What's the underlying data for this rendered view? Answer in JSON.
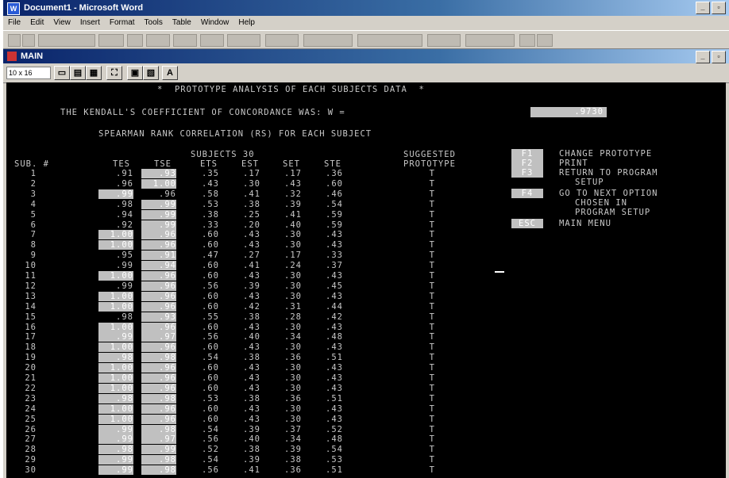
{
  "window": {
    "title": "Document1 - Microsoft Word"
  },
  "menu": [
    "File",
    "Edit",
    "View",
    "Insert",
    "Format",
    "Tools",
    "Table",
    "Window",
    "Help"
  ],
  "sub_window": {
    "title": "MAIN"
  },
  "dos_toolbar": {
    "font_size": "10 x 16"
  },
  "screen": {
    "header": "*  PROTOTYPE ANALYSIS OF EACH SUBJECTS DATA  *",
    "kendall_label": "THE KENDALL'S COEFFICIENT OF CONCORDANCE WAS: W =",
    "kendall_value": ".9730",
    "spearman_label": "SPEARMAN RANK CORRELATION (RS) FOR EACH SUBJECT",
    "subjects_label": "SUBJECTS 30",
    "suggested_label": "SUGGESTED",
    "prototype_label": "PROTOTYPE",
    "columns": [
      "SUB. #",
      "TES",
      "TSE",
      "ETS",
      "EST",
      "SET",
      "STE"
    ],
    "rows": [
      {
        "sub": "1",
        "tes": ".91",
        "tse": ".93",
        "ets": ".35",
        "est": ".17",
        "set": ".17",
        "ste": ".36",
        "p": "T"
      },
      {
        "sub": "2",
        "tes": ".96",
        "tse": "1.00",
        "ets": ".43",
        "est": ".30",
        "set": ".43",
        "ste": ".60",
        "p": "T"
      },
      {
        "sub": "3",
        "tes": ".99",
        "tse": ".96",
        "ets": ".58",
        "est": ".41",
        "set": ".32",
        "ste": ".46",
        "p": "T"
      },
      {
        "sub": "4",
        "tes": ".98",
        "tse": ".99",
        "ets": ".53",
        "est": ".38",
        "set": ".39",
        "ste": ".54",
        "p": "T"
      },
      {
        "sub": "5",
        "tes": ".94",
        "tse": ".99",
        "ets": ".38",
        "est": ".25",
        "set": ".41",
        "ste": ".59",
        "p": "T"
      },
      {
        "sub": "6",
        "tes": ".92",
        "tse": ".99",
        "ets": ".33",
        "est": ".20",
        "set": ".40",
        "ste": ".59",
        "p": "T"
      },
      {
        "sub": "7",
        "tes": "1.00",
        "tse": ".96",
        "ets": ".60",
        "est": ".43",
        "set": ".30",
        "ste": ".43",
        "p": "T"
      },
      {
        "sub": "8",
        "tes": "1.00",
        "tse": ".96",
        "ets": ".60",
        "est": ".43",
        "set": ".30",
        "ste": ".43",
        "p": "T"
      },
      {
        "sub": "9",
        "tes": ".95",
        "tse": ".91",
        "ets": ".47",
        "est": ".27",
        "set": ".17",
        "ste": ".33",
        "p": "T"
      },
      {
        "sub": "10",
        "tes": ".99",
        "tse": ".94",
        "ets": ".60",
        "est": ".41",
        "set": ".24",
        "ste": ".37",
        "p": "T"
      },
      {
        "sub": "11",
        "tes": "1.00",
        "tse": ".96",
        "ets": ".60",
        "est": ".43",
        "set": ".30",
        "ste": ".43",
        "p": "T"
      },
      {
        "sub": "12",
        "tes": ".99",
        "tse": ".96",
        "ets": ".56",
        "est": ".39",
        "set": ".30",
        "ste": ".45",
        "p": "T"
      },
      {
        "sub": "13",
        "tes": "1.00",
        "tse": ".96",
        "ets": ".60",
        "est": ".43",
        "set": ".30",
        "ste": ".43",
        "p": "T"
      },
      {
        "sub": "14",
        "tes": "1.00",
        "tse": ".96",
        "ets": ".60",
        "est": ".42",
        "set": ".31",
        "ste": ".44",
        "p": "T"
      },
      {
        "sub": "15",
        "tes": ".98",
        "tse": ".93",
        "ets": ".55",
        "est": ".38",
        "set": ".28",
        "ste": ".42",
        "p": "T"
      },
      {
        "sub": "16",
        "tes": "1.00",
        "tse": ".96",
        "ets": ".60",
        "est": ".43",
        "set": ".30",
        "ste": ".43",
        "p": "T"
      },
      {
        "sub": "17",
        "tes": ".99",
        "tse": ".97",
        "ets": ".56",
        "est": ".40",
        "set": ".34",
        "ste": ".48",
        "p": "T"
      },
      {
        "sub": "18",
        "tes": "1.00",
        "tse": ".96",
        "ets": ".60",
        "est": ".43",
        "set": ".30",
        "ste": ".43",
        "p": "T"
      },
      {
        "sub": "19",
        "tes": ".98",
        "tse": ".98",
        "ets": ".54",
        "est": ".38",
        "set": ".36",
        "ste": ".51",
        "p": "T"
      },
      {
        "sub": "20",
        "tes": "1.00",
        "tse": ".96",
        "ets": ".60",
        "est": ".43",
        "set": ".30",
        "ste": ".43",
        "p": "T"
      },
      {
        "sub": "21",
        "tes": "1.00",
        "tse": ".96",
        "ets": ".60",
        "est": ".43",
        "set": ".30",
        "ste": ".43",
        "p": "T"
      },
      {
        "sub": "22",
        "tes": "1.00",
        "tse": ".96",
        "ets": ".60",
        "est": ".43",
        "set": ".30",
        "ste": ".43",
        "p": "T"
      },
      {
        "sub": "23",
        "tes": ".98",
        "tse": ".98",
        "ets": ".53",
        "est": ".38",
        "set": ".36",
        "ste": ".51",
        "p": "T"
      },
      {
        "sub": "24",
        "tes": "1.00",
        "tse": ".96",
        "ets": ".60",
        "est": ".43",
        "set": ".30",
        "ste": ".43",
        "p": "T"
      },
      {
        "sub": "25",
        "tes": "1.00",
        "tse": ".96",
        "ets": ".60",
        "est": ".43",
        "set": ".30",
        "ste": ".43",
        "p": "T"
      },
      {
        "sub": "26",
        "tes": ".99",
        "tse": ".98",
        "ets": ".54",
        "est": ".39",
        "set": ".37",
        "ste": ".52",
        "p": "T"
      },
      {
        "sub": "27",
        "tes": ".99",
        "tse": ".97",
        "ets": ".56",
        "est": ".40",
        "set": ".34",
        "ste": ".48",
        "p": "T"
      },
      {
        "sub": "28",
        "tes": ".98",
        "tse": ".99",
        "ets": ".52",
        "est": ".38",
        "set": ".39",
        "ste": ".54",
        "p": "T"
      },
      {
        "sub": "29",
        "tes": ".99",
        "tse": ".98",
        "ets": ".54",
        "est": ".39",
        "set": ".38",
        "ste": ".53",
        "p": "T"
      },
      {
        "sub": "30",
        "tes": ".99",
        "tse": ".98",
        "ets": ".56",
        "est": ".41",
        "set": ".36",
        "ste": ".51",
        "p": "T"
      }
    ],
    "highlight_tes": [
      3,
      7,
      8,
      11,
      13,
      14,
      16,
      17,
      18,
      19,
      20,
      21,
      22,
      23,
      24,
      25,
      26,
      27,
      28,
      29,
      30
    ],
    "highlight_tse": [
      1,
      2,
      4,
      5,
      6,
      7,
      8,
      9,
      10,
      11,
      12,
      13,
      14,
      15,
      16,
      17,
      18,
      19,
      20,
      21,
      22,
      23,
      24,
      25,
      26,
      27,
      28,
      29,
      30
    ],
    "fkeys": [
      {
        "key": "F1",
        "label": "CHANGE PROTOTYPE"
      },
      {
        "key": "F2",
        "label": "PRINT"
      },
      {
        "key": "F3",
        "label": "RETURN TO PROGRAM"
      },
      {
        "key": "",
        "label": "SETUP"
      },
      {
        "key": "F4",
        "label": "GO TO NEXT OPTION"
      },
      {
        "key": "",
        "label": "CHOSEN IN"
      },
      {
        "key": "",
        "label": "PROGRAM SETUP"
      },
      {
        "key": "ESC",
        "label": "MAIN MENU"
      }
    ]
  },
  "colors": {
    "screen_bg": "#000000",
    "text": "#c8c8c8",
    "highlight": "#c0c0c0",
    "title_bar": "#0a246a"
  }
}
